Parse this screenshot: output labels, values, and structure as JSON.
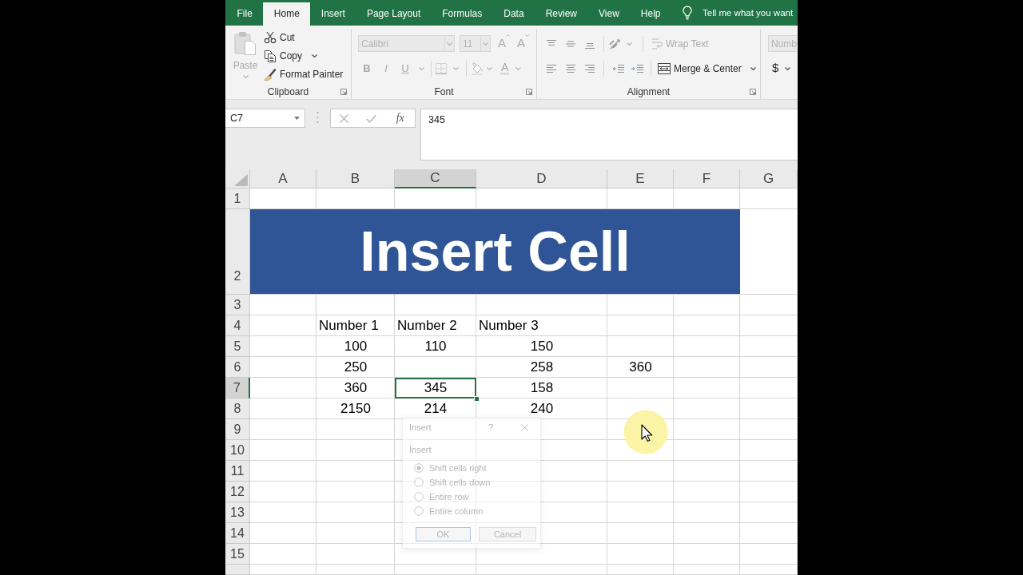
{
  "tabs": [
    {
      "label": "File",
      "selected": false
    },
    {
      "label": "Home",
      "selected": true
    },
    {
      "label": "Insert",
      "selected": false
    },
    {
      "label": "Page Layout",
      "selected": false
    },
    {
      "label": "Formulas",
      "selected": false
    },
    {
      "label": "Data",
      "selected": false
    },
    {
      "label": "Review",
      "selected": false
    },
    {
      "label": "View",
      "selected": false
    },
    {
      "label": "Help",
      "selected": false
    }
  ],
  "tell_me": {
    "label": "Tell me what you want"
  },
  "ribbon": {
    "clipboard": {
      "label": "Clipboard",
      "paste": {
        "label": "Paste",
        "disabled": true
      },
      "commands": [
        {
          "label": "Cut",
          "dropdown": false
        },
        {
          "label": "Copy",
          "dropdown": true
        },
        {
          "label": "Format Painter",
          "dropdown": false
        }
      ]
    },
    "font": {
      "label": "Font",
      "disabled": true,
      "font_name": {
        "value": "Calibri"
      },
      "font_size": {
        "value": "11"
      },
      "size_buttons": [
        {
          "label": "A"
        },
        {
          "label": "A"
        }
      ],
      "style_buttons": [
        {
          "label": "B"
        },
        {
          "label": "I"
        },
        {
          "label": "U"
        }
      ],
      "font_color": {
        "label": "A"
      }
    },
    "alignment": {
      "label": "Alignment",
      "wrap_text": {
        "label": "Wrap Text",
        "disabled": true
      },
      "merge_center": {
        "label": "Merge & Center",
        "disabled": false
      }
    },
    "number": {
      "format": {
        "value": "Numb"
      },
      "currency": {
        "label": "$"
      }
    }
  },
  "formula_bar": {
    "name_box": {
      "value": "C7"
    },
    "function_button": "fx",
    "formula": {
      "value": "345"
    }
  },
  "sheet": {
    "columns": [
      {
        "label": "A",
        "selected": false
      },
      {
        "label": "B",
        "selected": false
      },
      {
        "label": "C",
        "selected": true
      },
      {
        "label": "D",
        "selected": false
      },
      {
        "label": "E",
        "selected": false
      },
      {
        "label": "F",
        "selected": false
      },
      {
        "label": "G",
        "selected": false
      }
    ],
    "rows": [
      {
        "label": "1",
        "kind": "cells",
        "selected": false
      },
      {
        "label": "2",
        "kind": "banner",
        "selected": false,
        "title": "Insert Cell"
      },
      {
        "label": "3",
        "kind": "cells",
        "selected": false
      },
      {
        "label": "4",
        "kind": "cells",
        "selected": false,
        "cells": [
          null,
          {
            "value": "Number 1",
            "kind": "text",
            "selected": false
          },
          {
            "value": "Number 2",
            "kind": "text",
            "selected": false
          },
          {
            "value": "Number 3",
            "kind": "text",
            "selected": false
          }
        ]
      },
      {
        "label": "5",
        "kind": "cells",
        "selected": false,
        "cells": [
          null,
          {
            "value": "100",
            "kind": "number",
            "selected": false
          },
          {
            "value": "110",
            "kind": "number",
            "selected": false
          },
          {
            "value": "150",
            "kind": "number",
            "selected": false
          }
        ]
      },
      {
        "label": "6",
        "kind": "cells",
        "selected": false,
        "cells": [
          null,
          {
            "value": "250",
            "kind": "number",
            "selected": false
          },
          null,
          {
            "value": "258",
            "kind": "number",
            "selected": false
          },
          {
            "value": "360",
            "kind": "number",
            "selected": false
          }
        ]
      },
      {
        "label": "7",
        "kind": "cells",
        "selected": true,
        "cells": [
          null,
          {
            "value": "360",
            "kind": "number",
            "selected": false
          },
          {
            "value": "345",
            "kind": "number",
            "selected": true
          },
          {
            "value": "158",
            "kind": "number",
            "selected": false
          }
        ]
      },
      {
        "label": "8",
        "kind": "cells",
        "selected": false,
        "cells": [
          null,
          {
            "value": "2150",
            "kind": "number",
            "selected": false
          },
          {
            "value": "214",
            "kind": "number",
            "selected": false
          },
          {
            "value": "240",
            "kind": "number",
            "selected": false
          }
        ]
      },
      {
        "label": "9",
        "kind": "cells",
        "selected": false
      },
      {
        "label": "10",
        "kind": "cells",
        "selected": false
      },
      {
        "label": "11",
        "kind": "cells",
        "selected": false
      },
      {
        "label": "12",
        "kind": "cells",
        "selected": false
      },
      {
        "label": "13",
        "kind": "cells",
        "selected": false
      },
      {
        "label": "14",
        "kind": "cells",
        "selected": false
      },
      {
        "label": "15",
        "kind": "cells",
        "selected": false
      }
    ]
  },
  "dialog": {
    "title": "Insert",
    "help": "?",
    "group_label": "Insert",
    "options": [
      {
        "label": "Shift cells right",
        "selected": true
      },
      {
        "label": "Shift cells down",
        "selected": false
      },
      {
        "label": "Entire row",
        "selected": false
      },
      {
        "label": "Entire column",
        "selected": false
      }
    ],
    "buttons": [
      {
        "label": "OK",
        "default": true
      },
      {
        "label": "Cancel",
        "default": false
      }
    ]
  }
}
